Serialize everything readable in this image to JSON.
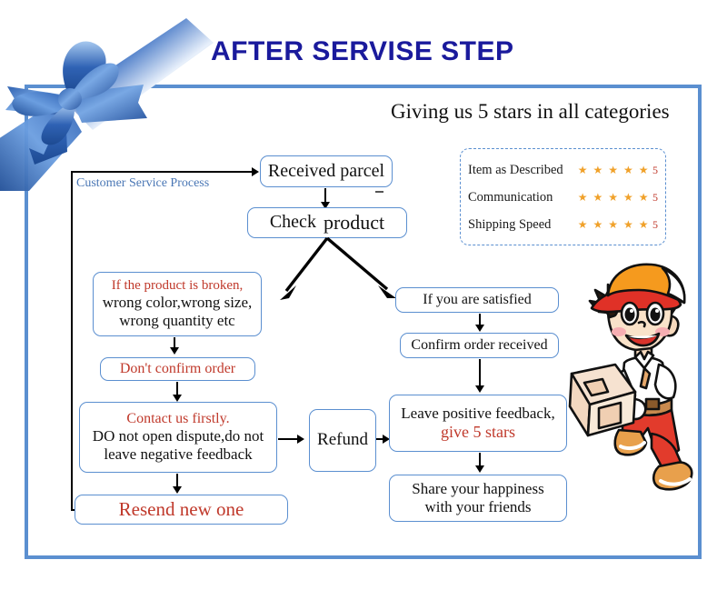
{
  "page": {
    "title": "AFTER SERVISE STEP",
    "frame_color": "#5b8fd0",
    "title_color": "#1a1a9c"
  },
  "rating_panel": {
    "headline": "Giving us 5 stars in all categories",
    "star_color": "#f0a12a",
    "score_color": "#c0392b",
    "rows": [
      {
        "label": "Item as Described",
        "stars": "★ ★ ★ ★ ★",
        "score": "5"
      },
      {
        "label": "Communication",
        "stars": "★ ★ ★ ★ ★",
        "score": "5"
      },
      {
        "label": "Shipping Speed",
        "stars": "★ ★ ★ ★ ★",
        "score": "5"
      }
    ]
  },
  "flow": {
    "process_label": "Customer Service Process",
    "received_parcel": "Received parcel",
    "check_product_1": "Check",
    "check_product_2": "product",
    "broken_line1": "If the product is broken,",
    "broken_line2": "wrong color,wrong size,",
    "broken_line3": "wrong quantity etc",
    "dont_confirm": "Don't confirm order",
    "contact_line1": "Contact us firstly.",
    "contact_line2": "DO not open dispute,do not",
    "contact_line3": "leave negative feedback",
    "resend": "Resend new one",
    "refund": "Refund",
    "satisfied": "If you are satisfied",
    "confirm_order": "Confirm order received",
    "feedback_line1": "Leave positive feedback,",
    "feedback_line2": "give 5 stars",
    "share_line1": "Share your happiness",
    "share_line2": "with your friends"
  },
  "illustration": {
    "ribbon_name": "blue-gift-ribbon-bow",
    "courier_name": "cartoon-delivery-courier-with-parcel"
  }
}
